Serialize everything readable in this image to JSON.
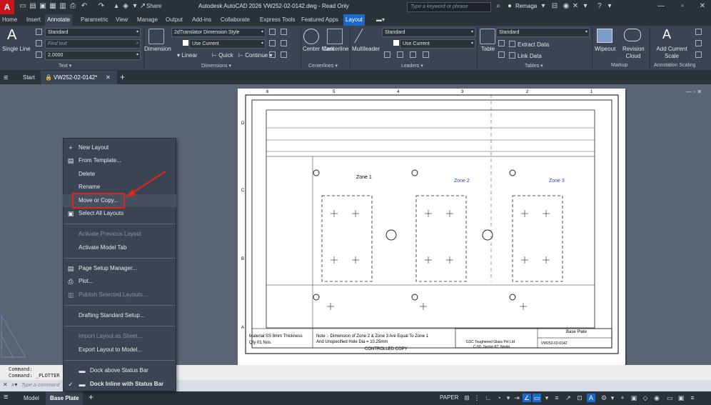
{
  "titlebar": {
    "app_logo": "A",
    "share": "Share",
    "title": "Autodesk AutoCAD 2026    VW252-02-0142.dwg - Read Only",
    "search_placeholder": "Type a keyword or phrase",
    "user": "Remaga"
  },
  "ribbon_tabs": [
    "Home",
    "Insert",
    "Annotate",
    "Parametric",
    "View",
    "Manage",
    "Output",
    "Add-ins",
    "Collaborate",
    "Express Tools",
    "Featured Apps",
    "Layout"
  ],
  "ribbon": {
    "text": {
      "single_line": "Single Line",
      "style": "Standard",
      "find_placeholder": "Find text",
      "height": "2.0000",
      "group": "Text"
    },
    "dimensions": {
      "dimension": "Dimension",
      "style": "2dTranslator Dimension Style",
      "layer": "Use Current",
      "linear": "Linear",
      "quick": "Quick",
      "continue": "Continue",
      "group": "Dimensions"
    },
    "centerlines": {
      "center_mark": "Center Mark",
      "centerline": "Centerline",
      "group": "Centerlines"
    },
    "leaders": {
      "multileader": "Multileader",
      "style": "Standard",
      "layer": "Use Current",
      "group": "Leaders"
    },
    "tables": {
      "table": "Table",
      "style": "Standard",
      "extract": "Extract Data",
      "link": "Link Data",
      "group": "Tables"
    },
    "markup": {
      "wipeout": "Wipeout",
      "revision_cloud": "Revision Cloud",
      "group": "Markup"
    },
    "annotation_scaling": {
      "add_scale": "Add Current Scale",
      "group": "Annotation Scaling"
    }
  },
  "doc_tabs": {
    "start": "Start",
    "active_doc": "VW252-02-0142*"
  },
  "drawing": {
    "top_numbers": [
      "6",
      "5",
      "4",
      "3",
      "2",
      "1"
    ],
    "side_letters": [
      "D",
      "C",
      "B",
      "A"
    ],
    "zone1": "Zone 1",
    "zone2": "Zone 2",
    "zone3": "Zone 3",
    "material": "Material SS 8mm Thickness",
    "qty": "Qty  01 Nos.",
    "note1": "Note :- Dimension of Zone 2  & Zone 3 Are Equal  To Zone 1",
    "note2": "And Unspecified Hole Dia = 10.25mm",
    "controlled": "CONTROLLED COPY",
    "company": "GSC Toughened Glass Pvt Ltd",
    "address": "C-50, Sector-67, Noida",
    "part_name": "Base Plate",
    "part_no": "VW252-02-0142"
  },
  "context_menu": {
    "items": [
      {
        "label": "New Layout",
        "icon": "new-layout-icon"
      },
      {
        "label": "From Template...",
        "icon": "template-icon"
      },
      {
        "label": "Delete",
        "icon": ""
      },
      {
        "label": "Rename",
        "icon": ""
      },
      {
        "label": "Move or Copy...",
        "icon": ""
      },
      {
        "label": "Select All Layouts",
        "icon": "select-all-icon"
      },
      {
        "label": "Activate Previous Layout",
        "icon": ""
      },
      {
        "label": "Activate Model Tab",
        "icon": ""
      },
      {
        "label": "Page Setup Manager...",
        "icon": "page-setup-icon"
      },
      {
        "label": "Plot...",
        "icon": "plot-icon"
      },
      {
        "label": "Publish Selected Layouts...",
        "icon": "publish-icon"
      },
      {
        "label": "Drafting Standard Setup...",
        "icon": ""
      },
      {
        "label": "Import Layout as Sheet...",
        "icon": ""
      },
      {
        "label": "Export Layout to Model...",
        "icon": ""
      },
      {
        "label": "Dock above Status Bar",
        "icon": "dock-above-icon"
      },
      {
        "label": "Dock Inline with Status Bar",
        "icon": "dock-inline-icon"
      }
    ]
  },
  "command": {
    "line1": "Command:",
    "line2": "Command:  _PLOTTER",
    "placeholder": "Type a command"
  },
  "statusbar": {
    "model": "Model",
    "active_layout": "Base Plate",
    "paper": "PAPER"
  },
  "colors": {
    "accent": "#1b6ac9",
    "highlight": "#e2231a",
    "menu_bg": "#3b4453"
  }
}
